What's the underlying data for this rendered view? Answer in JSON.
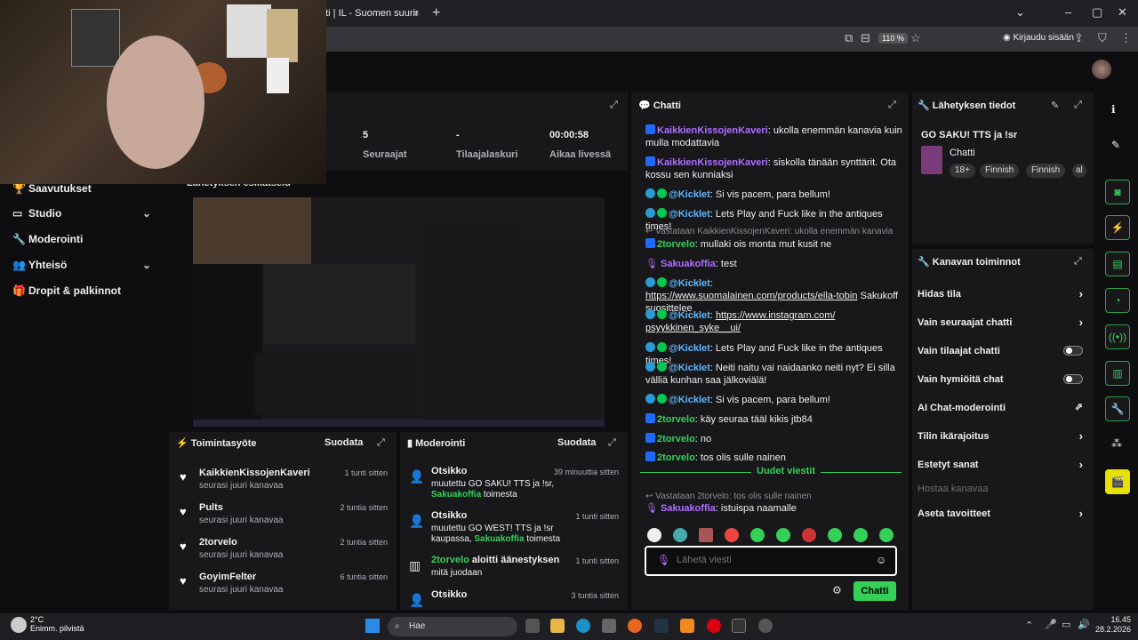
{
  "browser": {
    "tab_title": "hti | IL - Suomen suurin uu",
    "tab_close": "×",
    "new_tab": "+",
    "zoom": "110 %",
    "signin": "Kirjaudu sisään"
  },
  "nav": {
    "items": [
      {
        "label": "Saavutukset",
        "icon": "trophy-icon"
      },
      {
        "label": "Studio",
        "icon": "studio-icon",
        "chevron": "⌄"
      },
      {
        "label": "Moderointi",
        "icon": "wrench-icon"
      },
      {
        "label": "Yhteisö",
        "icon": "people-icon",
        "chevron": "⌄"
      },
      {
        "label": "Dropit & palkinnot",
        "icon": "gift-icon"
      }
    ]
  },
  "stats": {
    "followers": {
      "value": "5",
      "label": "Seuraajat"
    },
    "subs": {
      "value": "-",
      "label": "Tilaajalaskuri"
    },
    "live": {
      "value": "00:00:58",
      "label": "Aikaa livessä"
    }
  },
  "preview": {
    "title": "Lähetyksen esikatselu"
  },
  "activity": {
    "title": "Toimintasyöte",
    "filter": "Suodata",
    "rows": [
      {
        "name": "KaikkienKissojenKaveri",
        "sub": "seurasi juuri kanavaa",
        "time": "1 tunti sitten"
      },
      {
        "name": "Pults",
        "sub": "seurasi juuri kanavaa",
        "time": "2 tuntia sitten"
      },
      {
        "name": "2torvelo",
        "sub": "seurasi juuri kanavaa",
        "time": "2 tuntia sitten"
      },
      {
        "name": "GoyimFelter",
        "sub": "seurasi juuri kanavaa",
        "time": "6 tuntia sitten"
      }
    ]
  },
  "moderation": {
    "title": "Moderointi",
    "filter": "Suodata",
    "rows": [
      {
        "title": "Otsikko",
        "time": "39 minuuttia sitten",
        "pre": "muutettu GO SAKU! TTS ja !sr,",
        "user": "Sakuakoffia",
        "post": "toimesta"
      },
      {
        "title": "Otsikko",
        "time": "1 tunti sitten",
        "pre": "muutettu GO WEST! TTS ja !sr kaupassa,",
        "user": "Sakuakoffia",
        "post": "toimesta"
      },
      {
        "title_user": "2torvelo",
        "title": "aloitti äänestyksen",
        "time": "1 tunti sitten",
        "pre": "mitä juodaan"
      },
      {
        "title": "Otsikko",
        "time": "3 tuntia sitten"
      }
    ]
  },
  "chat": {
    "title": "Chatti",
    "new_messages": "Uudet viestit",
    "input_placeholder": "Lähetä viesti",
    "send": "Chatti",
    "messages": [
      {
        "user": "KaikkienKissojenKaveri",
        "text": ": ukolla enemmän kanavia kuin mulla modattavia"
      },
      {
        "user": "KaikkienKissojenKaveri",
        "text": ": siskolla tänään synttärit. Ota kossu sen kunniaksi"
      },
      {
        "user": "@Kicklet",
        "text": ": Si vis pacem, para bellum!"
      },
      {
        "user": "@Kicklet",
        "text": ": Lets Play and Fuck like in the antiques times!"
      },
      {
        "reply": "Vastataan KaikkienKissojenKaveri: ukolla enemmän kanavia ku...",
        "user": "2torvelo",
        "text": ": mullaki ois monta mut kusit ne"
      },
      {
        "user": "Sakuakoffia",
        "text": ": test"
      },
      {
        "user": "@Kicklet",
        "text": ": ",
        "link": "https://www.suomalainen.com/products/ella-tobin",
        "after": " Sakukoff suosittelee"
      },
      {
        "user": "@Kicklet",
        "text": ": ",
        "link": "https://www.instagram.com/ psyykkinen_syke__ui/"
      },
      {
        "user": "@Kicklet",
        "text": ": Lets Play and Fuck like in the antiques times!"
      },
      {
        "user": "@Kicklet",
        "text": ": Neiti naitu vai naidaanko neiti nyt? Ei silla välliä kunhan saa jälkoviälä!"
      },
      {
        "user": "@Kicklet",
        "text": ": Si vis pacem, para bellum!"
      },
      {
        "user": "2torvelo",
        "text": ": käy seuraa tääl kikis jtb84"
      },
      {
        "user": "2torvelo",
        "text": ": no"
      },
      {
        "user": "2torvelo",
        "text": ": tos olis sulle nainen"
      },
      {
        "reply": "Vastataan 2torvelo: tos olis sulle nainen",
        "user": "Sakuakoffia",
        "text": ": istuispa naamalle"
      }
    ]
  },
  "info": {
    "title": "Lähetyksen tiedot",
    "stream_title": "GO SAKU! TTS ja !sr",
    "category": "Chatti",
    "tags": [
      "18+",
      "Finnish",
      "Finnish",
      "al"
    ]
  },
  "actions": {
    "title": "Kanavan toiminnot",
    "rows": [
      {
        "label": "Hidas tila",
        "kind": "chevron"
      },
      {
        "label": "Vain seuraajat chatti",
        "kind": "chevron"
      },
      {
        "label": "Vain tilaajat chatti",
        "kind": "toggle"
      },
      {
        "label": "Vain hymiöitä chat",
        "kind": "toggle"
      },
      {
        "label": "AI Chat-moderointi",
        "kind": "external"
      },
      {
        "label": "Tilin ikärajoitus",
        "kind": "chevron"
      },
      {
        "label": "Estetyt sanat",
        "kind": "chevron"
      },
      {
        "label": "Hostaa kanavaa",
        "kind": "disabled"
      },
      {
        "label": "Aseta tavoitteet",
        "kind": "chevron"
      }
    ]
  },
  "taskbar": {
    "temp": "2°C",
    "weather": "Enimm. pilvistä",
    "search": "Hae",
    "time": "16.45",
    "date": "28.2.2026"
  },
  "colors": {
    "accent": "#34d058",
    "panel": "#18181b",
    "bg": "#0e0e10",
    "username_purple": "#b06dff",
    "username_blue": "#5fb6ff"
  }
}
